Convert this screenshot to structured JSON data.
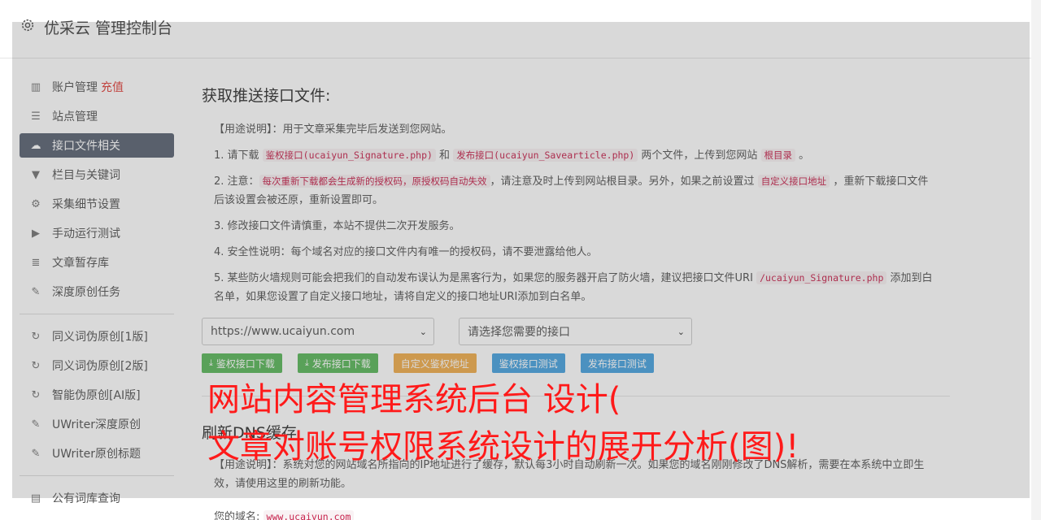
{
  "header": {
    "title": "优采云 管理控制台",
    "icon": "gear-icon"
  },
  "sidebar": {
    "items": [
      {
        "label": "账户管理",
        "badge": "充值",
        "icon": "bar-chart-icon",
        "glyph": "▥"
      },
      {
        "label": "站点管理",
        "icon": "list-icon",
        "glyph": "☰"
      },
      {
        "label": "接口文件相关",
        "icon": "cloud-upload-icon",
        "glyph": "☁",
        "active": true
      },
      {
        "label": "栏目与关键词",
        "icon": "filter-icon",
        "glyph": "▼"
      },
      {
        "label": "采集细节设置",
        "icon": "cogs-icon",
        "glyph": "⚙"
      },
      {
        "label": "手动运行测试",
        "icon": "play-circle-icon",
        "glyph": "▶"
      },
      {
        "label": "文章暂存库",
        "icon": "database-icon",
        "glyph": "≣"
      },
      {
        "label": "深度原创任务",
        "icon": "edit-icon",
        "glyph": "✎"
      }
    ],
    "items2": [
      {
        "label": "同义词伪原创[1版]",
        "icon": "refresh-icon",
        "glyph": "↻"
      },
      {
        "label": "同义词伪原创[2版]",
        "icon": "refresh-icon",
        "glyph": "↻"
      },
      {
        "label": "智能伪原创[AI版]",
        "icon": "refresh-icon",
        "glyph": "↻"
      },
      {
        "label": "UWriter深度原创",
        "icon": "edit-icon",
        "glyph": "✎"
      },
      {
        "label": "UWriter原创标题",
        "icon": "edit-icon",
        "glyph": "✎"
      }
    ],
    "items3": [
      {
        "label": "公有词库查询",
        "icon": "book-icon",
        "glyph": "▤"
      }
    ]
  },
  "main": {
    "title": "获取推送接口文件:",
    "usage": "【用途说明】：用于文章采集完毕后发送到您网站。",
    "p1": {
      "a": "1. 请下载 ",
      "code1": "鉴权接口(ucaiyun_Signature.php)",
      "b": " 和 ",
      "code2": "发布接口(ucaiyun_Savearticle.php)",
      "c": " 两个文件，上传到您网站 ",
      "code3": "根目录",
      "d": " 。"
    },
    "p2": {
      "a": "2. 注意：",
      "code1": "每次重新下载都会生成新的授权码，原授权码自动失效",
      "b": "，请注意及时上传到网站根目录。另外，如果之前设置过 ",
      "code2": "自定义接口地址",
      "c": " ，重新下载接口文件后该设置会被还原，重新设置即可。"
    },
    "p3": "3. 修改接口文件请慎重，本站不提供二次开发服务。",
    "p4": "4. 安全性说明：每个域名对应的接口文件内有唯一的授权码，请不要泄露给他人。",
    "p5": {
      "a": "5. 某些防火墙规则可能会把我们的自动发布误认为是黑客行为，如果您的服务器开启了防火墙，建议把接口文件URI ",
      "code1": "/ucaiyun_Signature.php",
      "b": " 添加到白名单，如果您设置了自定义接口地址，请将自定义的接口地址URI添加到白名单。"
    },
    "select_site": "https://www.ucaiyun.com",
    "select_api": "请选择您需要的接口",
    "buttons": {
      "download_auth": "鉴权接口下载",
      "download_publish": "发布接口下载",
      "custom_auth": "自定义鉴权地址",
      "test_auth": "鉴权接口测试",
      "test_publish": "发布接口测试"
    },
    "dns_title": "刷新DNS缓存",
    "dns_usage": "【用途说明】：系统对您的网站域名所指向的IP地址进行了缓存，默认每3小时自动刷新一次。如果您的域名刚刚修改了DNS解析，需要在本系统中立即生效，请使用这里的刷新功能。",
    "domain_label": "您的域名:",
    "domain_value": "www.ucaiyun.com"
  },
  "banner": {
    "line1": "网站内容管理系统后台 设计(",
    "line2": "文章对账号权限系统设计的展开分析(图)!"
  },
  "colors": {
    "active_nav": "#5b6574",
    "banner": "#ff1a1a",
    "code": "#c7254e"
  }
}
